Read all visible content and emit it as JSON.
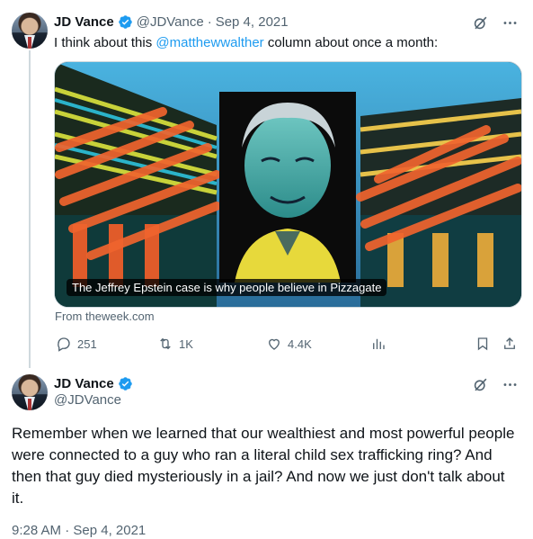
{
  "tweet1": {
    "author_name": "JD Vance",
    "author_handle": "@JDVance",
    "separator": "·",
    "date": "Sep 4, 2021",
    "text_before": "I think about this ",
    "mention": "@matthewwalther",
    "text_after": " column about once a month:",
    "card": {
      "caption": "The Jeffrey Epstein case is why people believe in Pizzagate",
      "source": "From theweek.com"
    },
    "actions": {
      "replies": "251",
      "retweets": "1K",
      "likes": "4.4K"
    }
  },
  "tweet2": {
    "author_name": "JD Vance",
    "author_handle": "@JDVance",
    "text": "Remember when we learned that our wealthiest and most powerful people were connected to a guy who ran a literal child sex trafficking ring? And then that guy died mysteriously in a jail? And now we just don't talk about it.",
    "timestamp": "9:28 AM · Sep 4, 2021"
  },
  "icons": {
    "verified": "verified-badge-icon",
    "grok": "grok-icon",
    "more": "more-options-icon",
    "reply": "reply-icon",
    "retweet": "retweet-icon",
    "like": "like-icon",
    "views": "views-icon",
    "bookmark": "bookmark-icon",
    "share": "share-icon"
  },
  "colors": {
    "accent": "#1d9bf0",
    "muted": "#536471",
    "text": "#0f1419",
    "border": "#cfd9de"
  }
}
